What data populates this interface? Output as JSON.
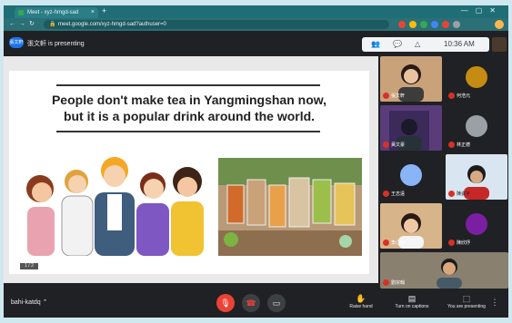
{
  "browser": {
    "tab_title": "Meet - xyz-hmgd-sad",
    "tab_close": "×",
    "new_tab": "+",
    "window_controls": "—▢✕",
    "url": "meet.google.com/xyz-hmgd-sad?authuser=0",
    "nav": "←→↻",
    "extension_colors": [
      "#ea4335",
      "#fbbc05",
      "#34a853",
      "#4285f4",
      "#ea4335"
    ]
  },
  "meet": {
    "presenter_initials": "張文軒",
    "presenter_text": "張文軒 is presenting",
    "time": "10:36 AM",
    "top_icons": [
      "people-icon",
      "chat-icon",
      "activities-icon"
    ],
    "meeting_code": "bahi-katdq",
    "participants": [
      {
        "name": "張文軒",
        "bg": "#c9a27a"
      },
      {
        "name": "何浩元",
        "bg": "#202124",
        "avatar": "#c58b12"
      },
      {
        "name": "黃文豪",
        "bg": "#5a3c7a"
      },
      {
        "name": "林正德",
        "bg": "#202124",
        "avatar": "#9aa0a6"
      },
      {
        "name": "王志遠",
        "bg": "#202124",
        "avatar": "#8ab4f8"
      },
      {
        "name": "陳姿宇",
        "bg": "#d9e6f2"
      },
      {
        "name": "李心怡",
        "bg": "#d8b48a"
      },
      {
        "name": "陳欣妤",
        "bg": "#202124",
        "avatar": "#7b1fa2"
      },
      {
        "name": "劉宗翰",
        "bg": "#8a8070"
      }
    ],
    "bottom": {
      "raise_hand": "Raise hand",
      "captions": "Turn on captions",
      "presenting": "You are presenting"
    }
  },
  "slide": {
    "line1": "People don't make tea in Yangmingshan now,",
    "line2": "but it is a popular drink around the world.",
    "footer": "1 / 2"
  }
}
